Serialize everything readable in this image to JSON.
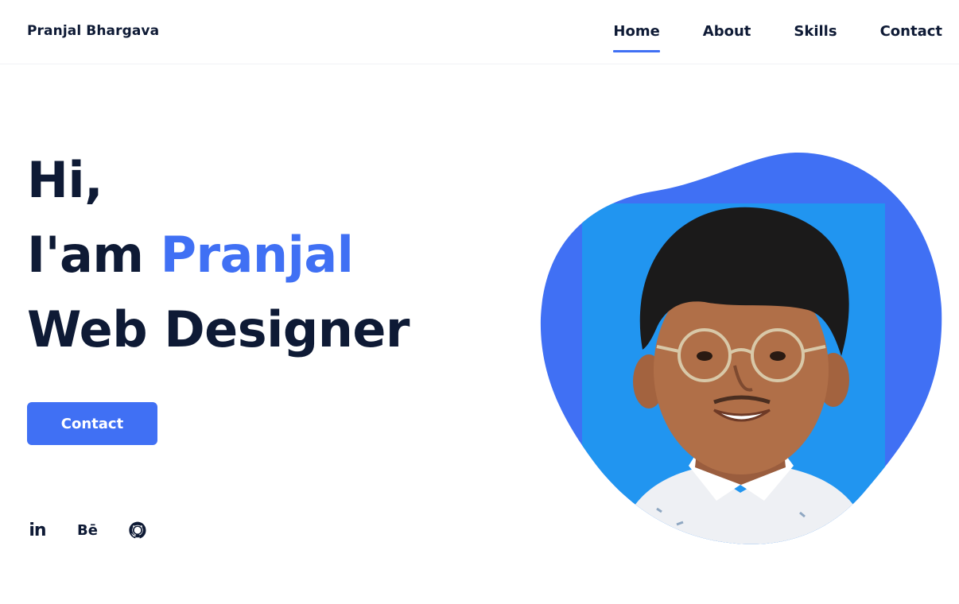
{
  "header": {
    "logo": "Pranjal Bhargava",
    "nav": [
      {
        "label": "Home",
        "active": true
      },
      {
        "label": "About",
        "active": false
      },
      {
        "label": "Skills",
        "active": false
      },
      {
        "label": "Contact",
        "active": false
      }
    ]
  },
  "hero": {
    "line1": "Hi,",
    "line2_prefix": "I'am ",
    "line2_name": "Pranjal",
    "line3": "Web Designer",
    "cta_label": "Contact"
  },
  "socials": [
    {
      "icon": "linkedin-icon",
      "text": "in"
    },
    {
      "icon": "behance-icon",
      "text": "Bē"
    },
    {
      "icon": "github-icon",
      "text": ""
    }
  ],
  "colors": {
    "accent": "#4070f4",
    "text": "#0e1a35",
    "photo_bg": "#2195f0"
  }
}
